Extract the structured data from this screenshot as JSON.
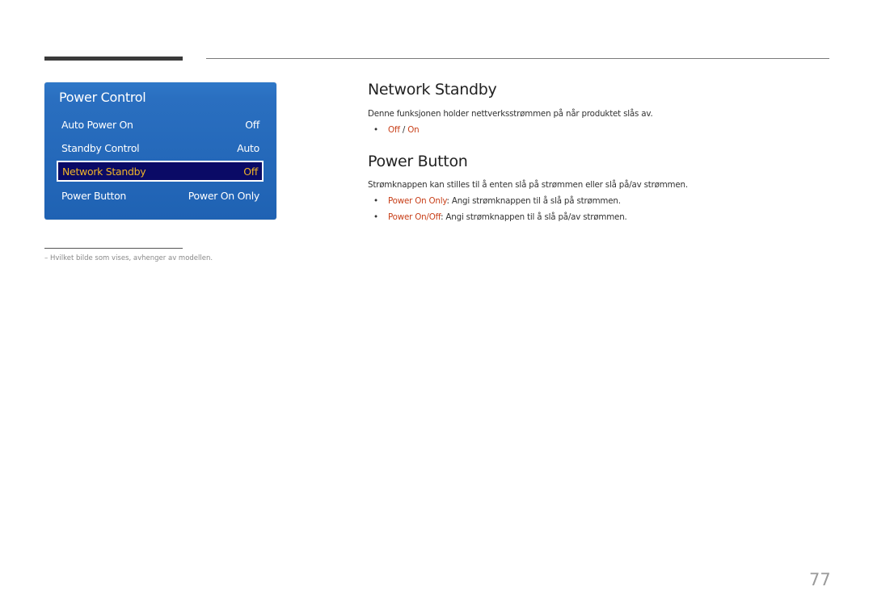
{
  "menu": {
    "title": "Power Control",
    "items": [
      {
        "label": "Auto Power On",
        "value": "Off"
      },
      {
        "label": "Standby Control",
        "value": "Auto"
      },
      {
        "label": "Network Standby",
        "value": "Off",
        "selected": true
      },
      {
        "label": "Power Button",
        "value": "Power On Only"
      }
    ]
  },
  "sections": [
    {
      "heading": "Network Standby",
      "description": "Denne funksjonen holder nettverksstrømmen på når produktet slås av.",
      "bullets": [
        {
          "option_a": "Off",
          "separator": " / ",
          "option_b": "On"
        }
      ]
    },
    {
      "heading": "Power Button",
      "description": "Strømknappen kan stilles til å enten slå på strømmen eller slå på/av strømmen.",
      "bullets": [
        {
          "term": "Power On Only",
          "text": ": Angi strømknappen til å slå på strømmen."
        },
        {
          "term": "Power On/Off",
          "text": ": Angi strømknappen til å slå på/av strømmen."
        }
      ]
    }
  ],
  "footnote": "–  Hvilket bilde som vises, avhenger av modellen.",
  "page_number": "77",
  "colors": {
    "menu_bg": "#1f62b3",
    "selected_bg": "#0a0a66",
    "selected_text": "#f0b429",
    "accent_text": "#c8401a"
  },
  "bullet_glyph": "•"
}
